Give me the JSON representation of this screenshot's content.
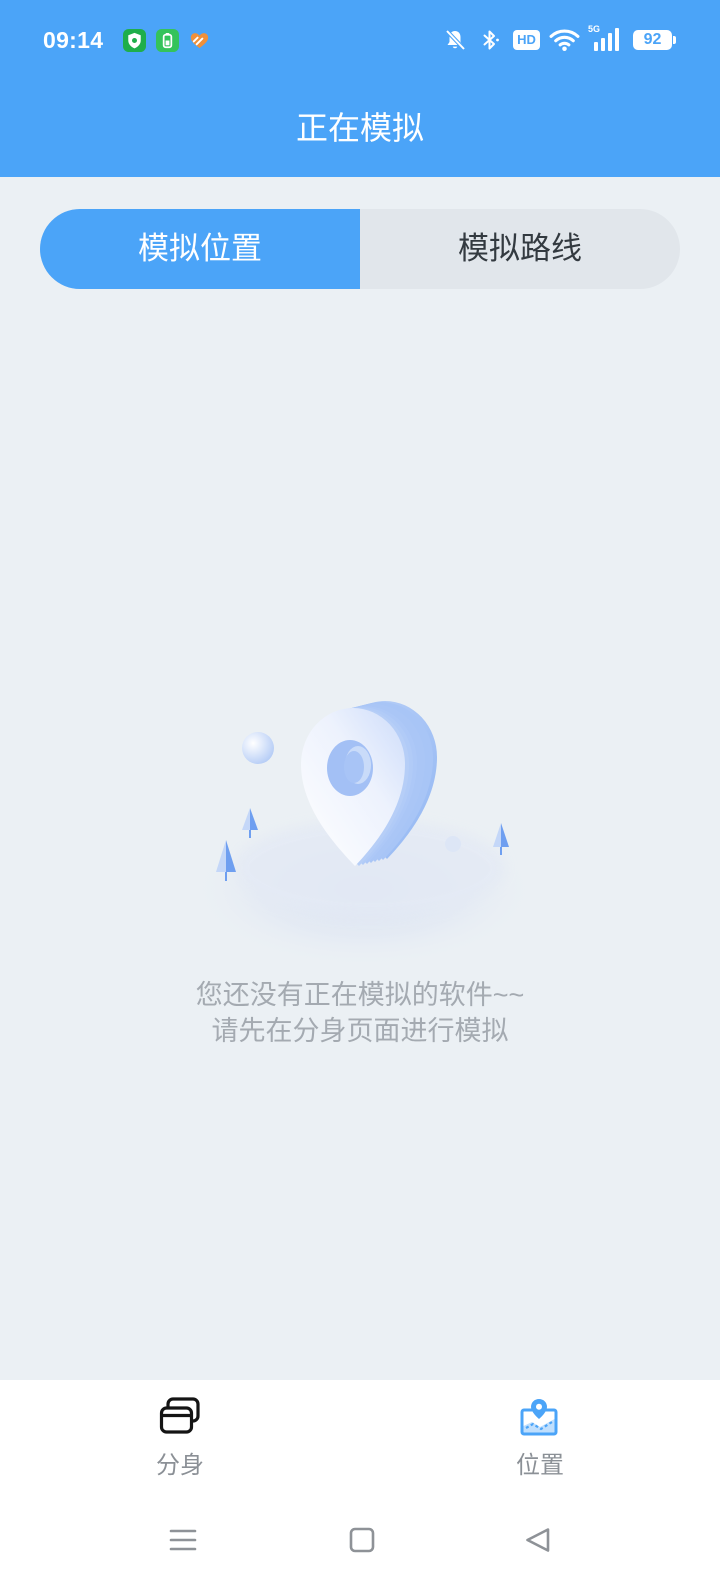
{
  "status_bar": {
    "time": "09:14",
    "left_icons": [
      "shield-app-icon",
      "battery-app-icon",
      "health-app-icon"
    ],
    "right_icons": [
      "bell-muted-icon",
      "bluetooth-icon",
      "hd-icon",
      "wifi-icon",
      "signal-5g-icon",
      "battery-icon"
    ],
    "hd_label": "HD",
    "network_label": "5G",
    "battery_level": "92"
  },
  "header": {
    "title": "正在模拟"
  },
  "tabs": [
    {
      "label": "模拟位置",
      "active": true
    },
    {
      "label": "模拟路线",
      "active": false
    }
  ],
  "empty_state": {
    "illustration": "location-pin-illustration",
    "line1": "您还没有正在模拟的软件~~",
    "line2": "请先在分身页面进行模拟"
  },
  "bottom_nav": [
    {
      "label": "分身",
      "icon": "cards-icon",
      "active": false
    },
    {
      "label": "位置",
      "icon": "map-pin-icon",
      "active": true
    }
  ],
  "system_nav": {
    "icons": [
      "menu-icon",
      "home-icon",
      "back-icon"
    ]
  },
  "colors": {
    "primary": "#4ba4f8",
    "background": "#ebf0f4",
    "tab_inactive": "#e1e6eb",
    "muted_text": "#a4aab1",
    "nav_label": "#8b9096",
    "system_icon": "#8e9297"
  }
}
